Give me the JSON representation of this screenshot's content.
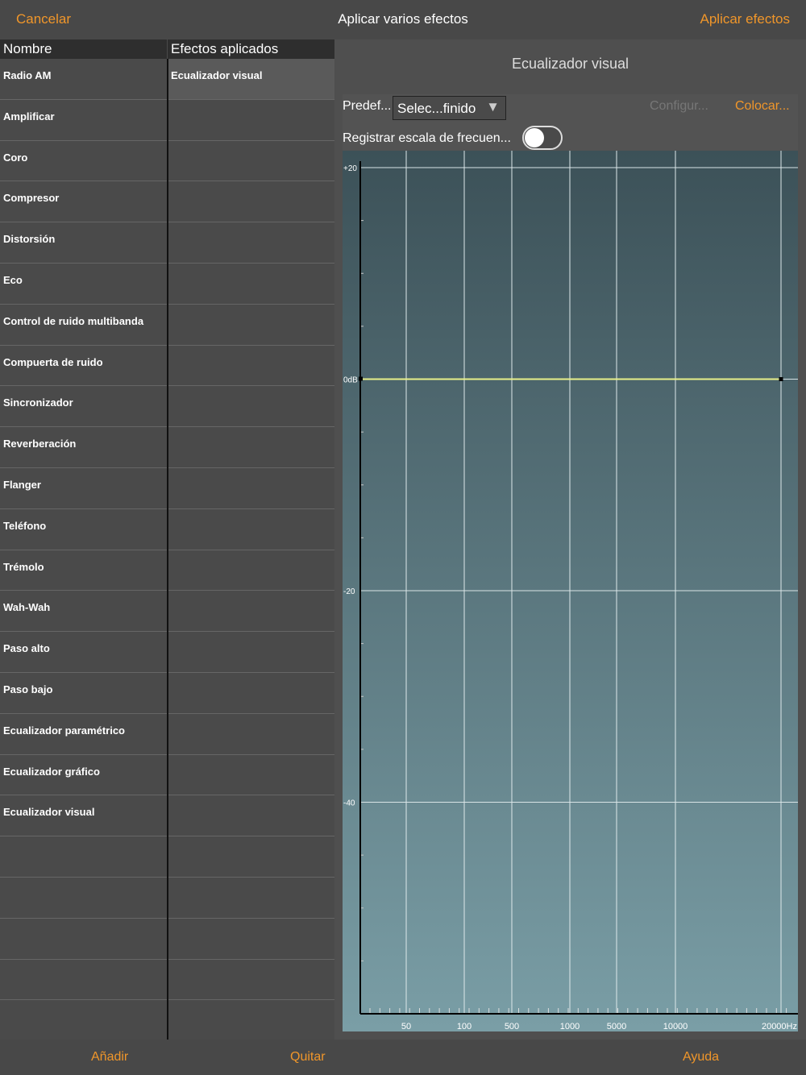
{
  "topbar": {
    "cancel": "Cancelar",
    "title": "Aplicar varios efectos",
    "apply": "Aplicar efectos"
  },
  "columns": {
    "name": "Nombre",
    "applied": "Efectos aplicados"
  },
  "effects": [
    "Radio AM",
    "Amplificar",
    "Coro",
    "Compresor",
    "Distorsión",
    "Eco",
    "Control de ruido multibanda",
    "Compuerta de ruido",
    "Sincronizador",
    "Reverberación",
    "Flanger",
    "Teléfono",
    "Trémolo",
    "Wah-Wah",
    "Paso alto",
    "Paso bajo",
    "Ecualizador paramétrico",
    "Ecualizador gráfico",
    "Ecualizador visual"
  ],
  "applied": [
    "Ecualizador visual"
  ],
  "panel": {
    "title": "Ecualizador visual",
    "preset_label": "Predef...",
    "preset_value": "Selec...finido",
    "config": "Configur...",
    "place": "Colocar...",
    "log_label": "Registrar escala de frecuen...",
    "log_on": false
  },
  "chart_data": {
    "type": "line",
    "y_ticks": [
      "+20",
      "0dB",
      "-20",
      "-40"
    ],
    "x_ticks": [
      "50",
      "100",
      "500",
      "1000",
      "5000",
      "10000",
      "20000Hz"
    ],
    "ylim": [
      -60,
      20
    ],
    "series": [
      {
        "points": [
          [
            20,
            0
          ],
          [
            20000,
            0
          ]
        ]
      }
    ],
    "line_color": "#e8f08a",
    "grid": true
  },
  "footer": {
    "add": "Añadir",
    "remove": "Quitar",
    "help": "Ayuda"
  }
}
